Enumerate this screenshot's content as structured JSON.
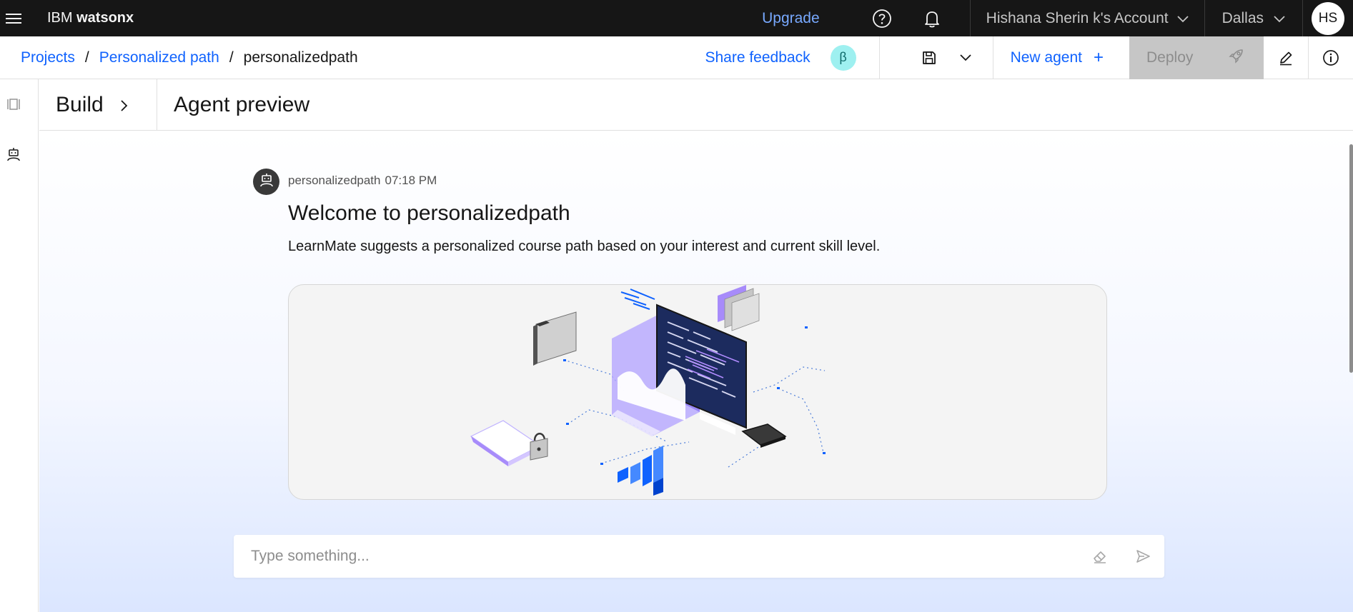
{
  "topbar": {
    "brand_prefix": "IBM",
    "brand_name": "watsonx",
    "upgrade_label": "Upgrade",
    "account_label": "Hishana Sherin k's Account",
    "region_label": "Dallas",
    "avatar_initials": "HS"
  },
  "breadcrumb": {
    "items": [
      "Projects",
      "Personalized path"
    ],
    "separator": "/",
    "current": "personalizedpath"
  },
  "toolbar": {
    "share_feedback_label": "Share feedback",
    "beta_badge": "β",
    "new_agent_label": "New agent",
    "new_agent_plus": "+",
    "deploy_label": "Deploy"
  },
  "panel": {
    "build_label": "Build",
    "preview_title": "Agent preview"
  },
  "message": {
    "sender": "personalizedpath",
    "time": "07:18 PM",
    "title": "Welcome to personalizedpath",
    "body": "LearnMate suggests a personalized course path based on your interest and current skill level."
  },
  "chat_input": {
    "placeholder": "Type something...",
    "value": ""
  },
  "icons": {
    "menu": "hamburger-icon",
    "help": "help-icon",
    "notifications": "bell-icon",
    "save": "save-icon",
    "deploy": "rocket-icon",
    "edit": "pencil-icon",
    "info": "info-icon",
    "clear": "eraser-icon",
    "send": "send-icon",
    "agent": "robot-icon"
  },
  "colors": {
    "topbar_bg": "#161616",
    "link_blue": "#0f62fe",
    "upgrade_blue": "#78a9ff",
    "beta_bg": "#9ef0f0",
    "deploy_disabled": "#c6c6c6",
    "illustration_purple": "#a78bfa",
    "illustration_blue": "#0f62fe"
  }
}
